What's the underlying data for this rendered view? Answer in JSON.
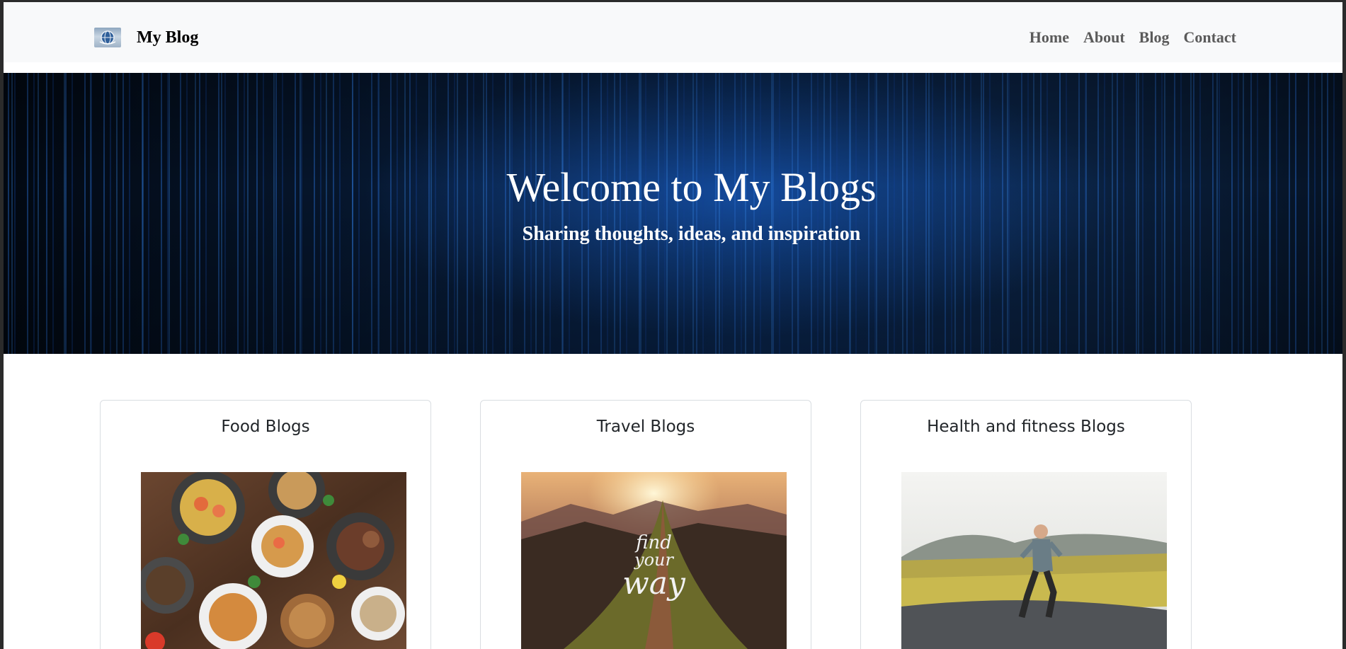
{
  "navbar": {
    "brand": "My Blog",
    "links": [
      "Home",
      "About",
      "Blog",
      "Contact"
    ]
  },
  "hero": {
    "title": "Welcome to My Blogs",
    "subtitle": "Sharing thoughts, ideas, and inspiration"
  },
  "cards": [
    {
      "title": "Food Blogs"
    },
    {
      "title": "Travel Blogs",
      "image_text": [
        "find",
        "your",
        "way"
      ]
    },
    {
      "title": "Health and fitness Blogs"
    }
  ],
  "icons": {
    "logo": "globe-logo-icon"
  }
}
